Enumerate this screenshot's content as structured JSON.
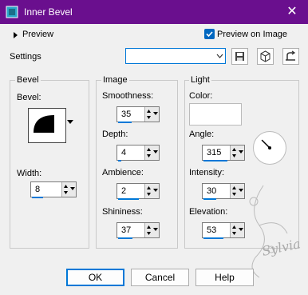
{
  "window": {
    "title": "Inner Bevel"
  },
  "preview": {
    "expander_label": "Preview",
    "check_label": "Preview on Image",
    "checked": true
  },
  "settings": {
    "label": "Settings",
    "value": ""
  },
  "bevel_group": {
    "title": "Bevel",
    "bevel_label": "Bevel:",
    "width_label": "Width:",
    "width_value": "8"
  },
  "image_group": {
    "title": "Image",
    "smoothness_label": "Smoothness:",
    "smoothness_value": "35",
    "depth_label": "Depth:",
    "depth_value": "4",
    "ambience_label": "Ambience:",
    "ambience_value": "2",
    "shininess_label": "Shininess:",
    "shininess_value": "37"
  },
  "light_group": {
    "title": "Light",
    "color_label": "Color:",
    "color_value": "#ffffff",
    "angle_label": "Angle:",
    "angle_value": "315",
    "intensity_label": "Intensity:",
    "intensity_value": "30",
    "elevation_label": "Elevation:",
    "elevation_value": "53"
  },
  "buttons": {
    "ok": "OK",
    "cancel": "Cancel",
    "help": "Help"
  },
  "watermark": {
    "text": "Sylvia"
  },
  "colors": {
    "titlebar": "#6a0f8e",
    "accent": "#0078d7"
  }
}
